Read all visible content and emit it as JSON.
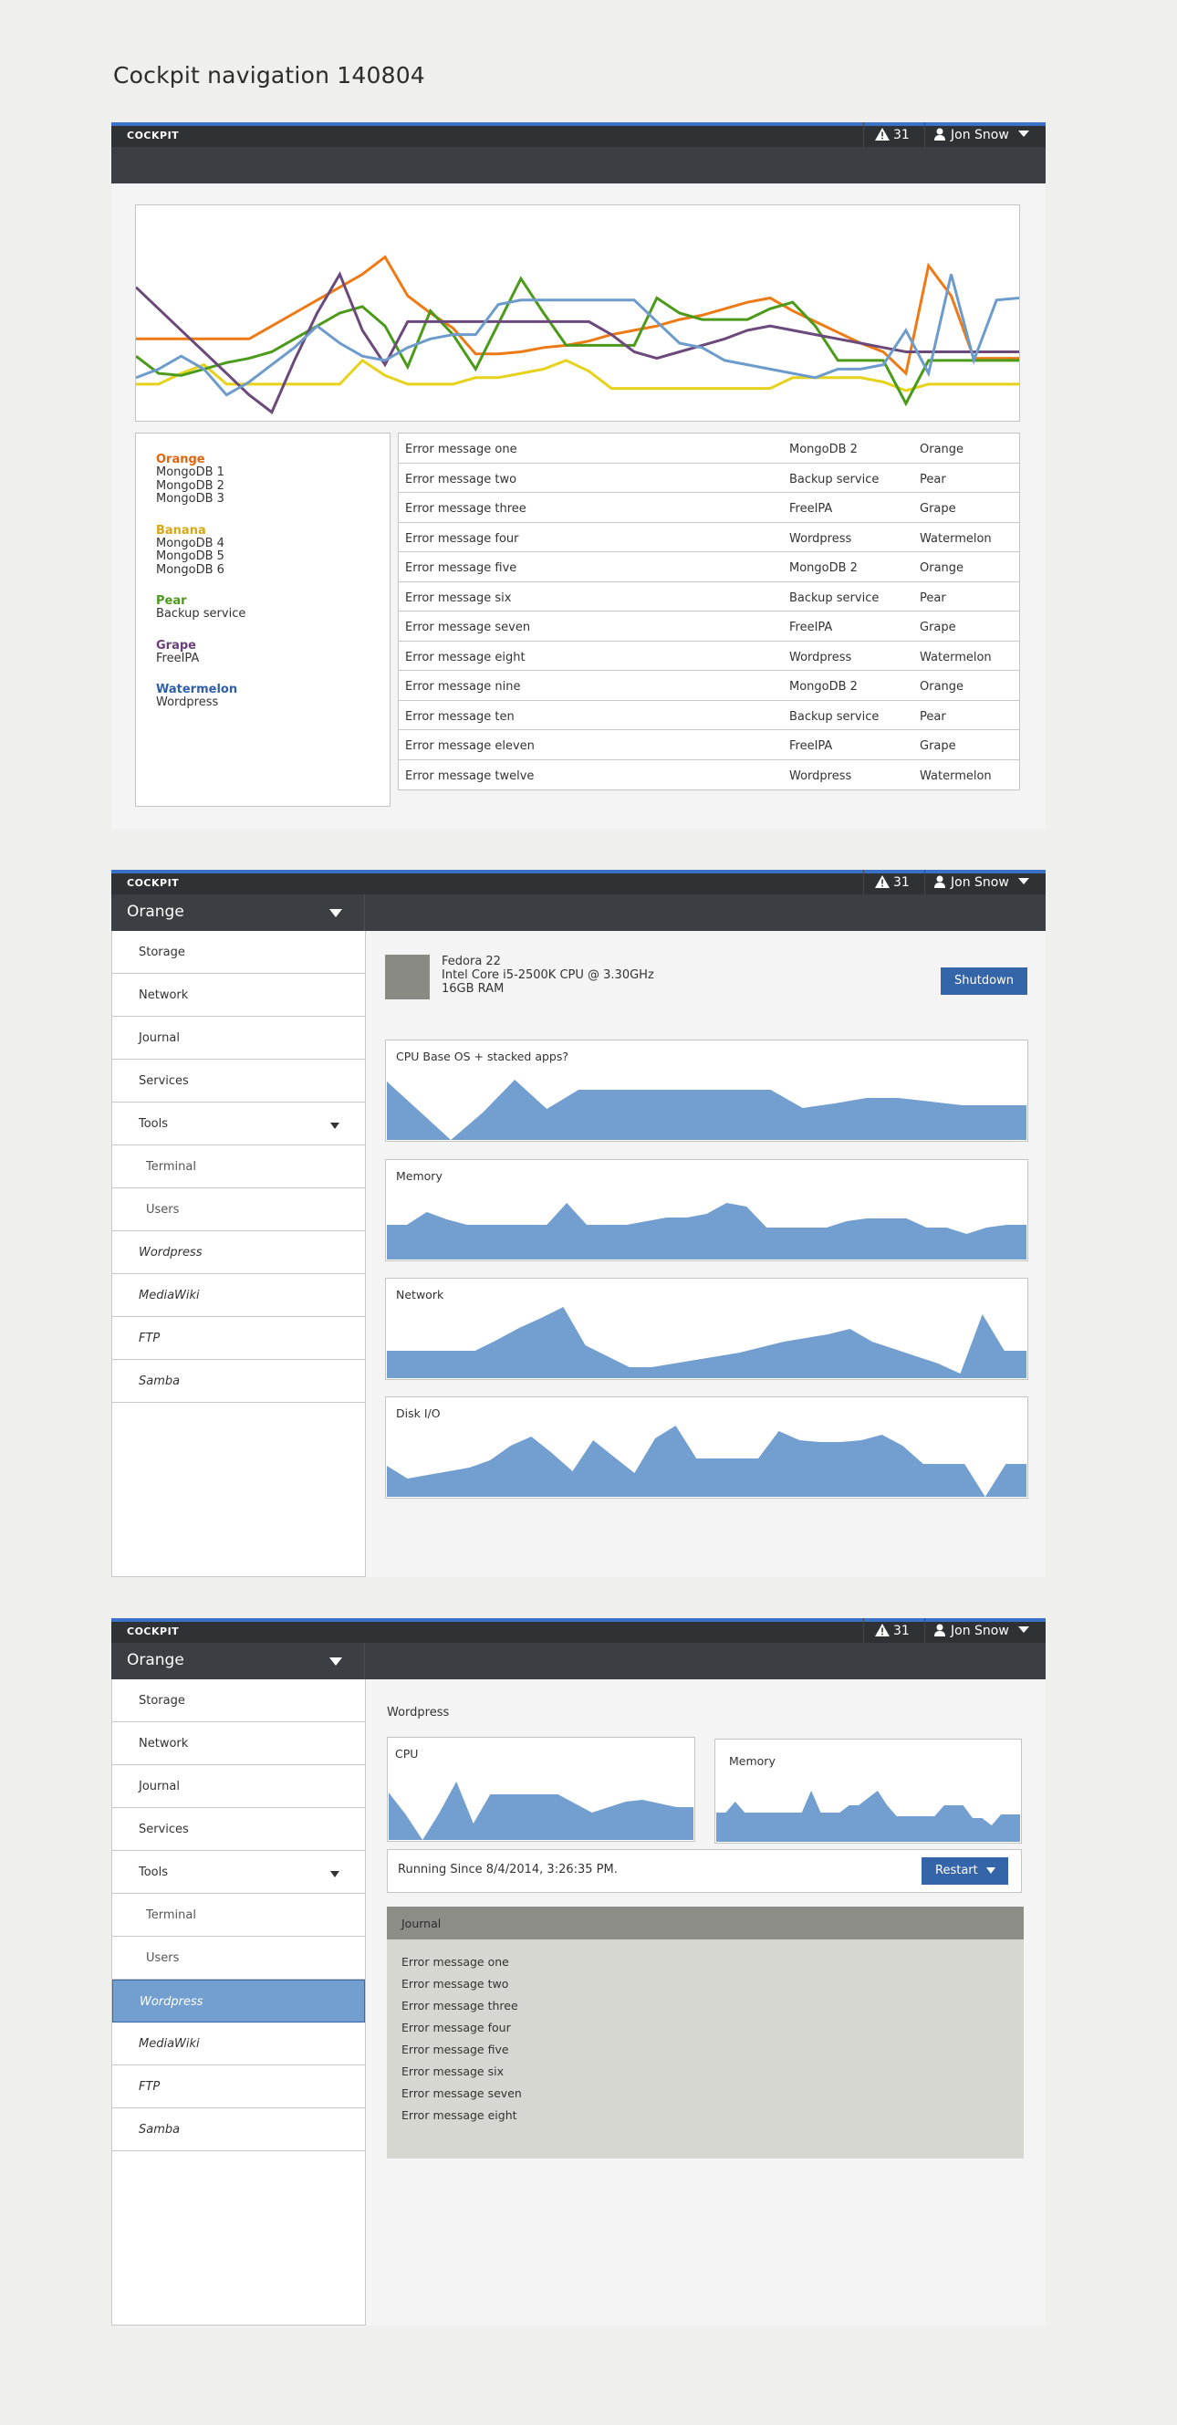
{
  "page": {
    "title": "Cockpit navigation 140804"
  },
  "topbar": {
    "brand": "COCKPIT",
    "alerts": "31",
    "user": "Jon Snow"
  },
  "colors": {
    "orange": "#ee7a15",
    "banana": "#e6d21a",
    "pear": "#4c9a1a",
    "grape": "#6b4a7b",
    "watermelon": "#6d9ccc",
    "accent_blue": "#3565a9",
    "graph_fill": "#729fcf",
    "topbar_stripe": "#3a72c6"
  },
  "mock1": {
    "chart_data": {
      "type": "line",
      "title": "",
      "xlabel": "",
      "ylabel": "",
      "grid": false,
      "x": [
        0,
        1,
        2,
        3,
        4,
        5,
        6,
        7,
        8,
        9,
        10,
        11,
        12,
        13,
        14,
        15,
        16,
        17,
        18,
        19,
        20,
        21,
        22,
        23,
        24,
        25,
        26,
        27,
        28,
        29,
        30,
        31,
        32,
        33,
        34,
        35,
        36,
        37,
        38,
        39,
        40,
        41,
        42,
        43,
        44,
        45,
        46,
        47,
        48,
        49,
        50
      ],
      "ylim": [
        0,
        100
      ],
      "series": [
        {
          "name": "Orange",
          "color": "#ee7a15",
          "values": [
            38,
            38,
            38,
            38,
            38,
            38,
            44,
            50,
            56,
            62,
            68,
            76,
            58,
            50,
            43,
            31,
            31,
            32,
            34,
            35,
            37,
            40,
            42,
            44,
            47,
            49,
            52,
            55,
            57,
            51,
            46,
            41,
            36,
            32,
            22,
            72,
            58,
            29,
            29,
            29
          ]
        },
        {
          "name": "Banana",
          "color": "#e6d21a",
          "values": [
            17,
            17,
            22,
            26,
            17,
            17,
            17,
            17,
            17,
            17,
            28,
            21,
            17,
            17,
            17,
            20,
            20,
            22,
            24,
            28,
            23,
            15,
            15,
            15,
            15,
            15,
            15,
            15,
            15,
            20,
            20,
            20,
            20,
            18,
            14,
            17,
            17,
            17,
            17,
            17
          ]
        },
        {
          "name": "Pear",
          "color": "#4c9a1a",
          "values": [
            30,
            22,
            21,
            24,
            27,
            29,
            32,
            38,
            44,
            50,
            53,
            44,
            25,
            51,
            40,
            24,
            45,
            66,
            50,
            35,
            35,
            35,
            35,
            57,
            50,
            47,
            47,
            47,
            52,
            55,
            44,
            28,
            28,
            28,
            8,
            28,
            28,
            28,
            28,
            28
          ]
        },
        {
          "name": "Grape",
          "color": "#6b4a7b",
          "values": [
            62,
            52,
            42,
            32,
            22,
            12,
            4,
            28,
            50,
            68,
            42,
            26,
            46,
            46,
            46,
            46,
            46,
            46,
            46,
            46,
            46,
            40,
            32,
            29,
            32,
            35,
            38,
            42,
            44,
            42,
            40,
            38,
            36,
            34,
            32,
            32,
            32,
            32,
            32,
            32
          ]
        },
        {
          "name": "Watermelon",
          "color": "#6d9ccc",
          "values": [
            20,
            24,
            30,
            24,
            12,
            18,
            26,
            34,
            44,
            36,
            30,
            28,
            34,
            38,
            40,
            40,
            54,
            56,
            56,
            56,
            56,
            56,
            56,
            46,
            36,
            34,
            28,
            26,
            24,
            22,
            20,
            24,
            24,
            26,
            42,
            22,
            68,
            28,
            56,
            57
          ]
        }
      ]
    },
    "legend": [
      {
        "name": "Orange",
        "color": "#e0650f",
        "items": [
          "MongoDB 1",
          "MongoDB 2",
          "MongoDB 3"
        ]
      },
      {
        "name": "Banana",
        "color": "#d9a716",
        "items": [
          "MongoDB 4",
          "MongoDB 5",
          "MongoDB 6"
        ]
      },
      {
        "name": "Pear",
        "color": "#4c9a1a",
        "items": [
          "Backup service"
        ]
      },
      {
        "name": "Grape",
        "color": "#6b3f7b",
        "items": [
          "FreeIPA"
        ]
      },
      {
        "name": "Watermelon",
        "color": "#2f5fa8",
        "items": [
          "Wordpress"
        ]
      }
    ],
    "errors": [
      {
        "msg": "Error message one",
        "service": "MongoDB 2",
        "group": "Orange"
      },
      {
        "msg": "Error message two",
        "service": "Backup service",
        "group": "Pear"
      },
      {
        "msg": "Error message three",
        "service": "FreeIPA",
        "group": "Grape"
      },
      {
        "msg": "Error message four",
        "service": "Wordpress",
        "group": "Watermelon"
      },
      {
        "msg": "Error message five",
        "service": "MongoDB 2",
        "group": "Orange"
      },
      {
        "msg": "Error message six",
        "service": "Backup service",
        "group": "Pear"
      },
      {
        "msg": "Error message seven",
        "service": "FreeIPA",
        "group": "Grape"
      },
      {
        "msg": "Error message eight",
        "service": "Wordpress",
        "group": "Watermelon"
      },
      {
        "msg": "Error message nine",
        "service": "MongoDB 2",
        "group": "Orange"
      },
      {
        "msg": "Error message ten",
        "service": "Backup service",
        "group": "Pear"
      },
      {
        "msg": "Error message eleven",
        "service": "FreeIPA",
        "group": "Grape"
      },
      {
        "msg": "Error message twelve",
        "service": "Wordpress",
        "group": "Watermelon"
      }
    ]
  },
  "mock2": {
    "selector": "Orange",
    "nav": [
      {
        "label": "Storage",
        "kind": "top"
      },
      {
        "label": "Network",
        "kind": "top"
      },
      {
        "label": "Journal",
        "kind": "top"
      },
      {
        "label": "Services",
        "kind": "top"
      },
      {
        "label": "Tools",
        "kind": "top",
        "expand": true
      },
      {
        "label": "Terminal",
        "kind": "sub"
      },
      {
        "label": "Users",
        "kind": "sub"
      },
      {
        "label": "Wordpress",
        "kind": "app"
      },
      {
        "label": "MediaWiki",
        "kind": "app"
      },
      {
        "label": "FTP",
        "kind": "app"
      },
      {
        "label": "Samba",
        "kind": "app"
      }
    ],
    "server": {
      "os": "Fedora 22",
      "cpu": "Intel Core i5-2500K CPU @ 3.30GHz",
      "ram": "16GB RAM"
    },
    "shutdown_label": "Shutdown",
    "graphs": [
      {
        "label": "CPU Base OS + stacked apps?",
        "values": [
          64,
          32,
          0,
          30,
          66,
          34,
          55,
          55,
          55,
          55,
          55,
          55,
          55,
          35,
          40,
          46,
          46,
          42,
          38,
          38,
          38
        ]
      },
      {
        "label": "Memory",
        "values": [
          38,
          38,
          52,
          44,
          38,
          38,
          38,
          38,
          38,
          62,
          38,
          38,
          38,
          42,
          46,
          46,
          50,
          62,
          58,
          35,
          35,
          35,
          35,
          42,
          45,
          45,
          45,
          35,
          35,
          28,
          35,
          38,
          38
        ]
      },
      {
        "label": "Network",
        "values": [
          30,
          30,
          30,
          30,
          30,
          42,
          55,
          66,
          78,
          36,
          24,
          12,
          12,
          16,
          20,
          24,
          28,
          34,
          40,
          44,
          48,
          54,
          40,
          32,
          24,
          16,
          5,
          70,
          30,
          30
        ]
      },
      {
        "label": "Disk I/O",
        "values": [
          34,
          20,
          24,
          28,
          32,
          40,
          56,
          66,
          48,
          28,
          62,
          44,
          26,
          64,
          78,
          42,
          42,
          42,
          42,
          72,
          62,
          60,
          60,
          62,
          68,
          56,
          36,
          36,
          36,
          0,
          36,
          36
        ]
      }
    ]
  },
  "mock3": {
    "selector": "Orange",
    "active_nav": "Wordpress",
    "section": "Wordpress",
    "cpu_label": "CPU",
    "memory_label": "Memory",
    "cpu_values": [
      52,
      28,
      0,
      30,
      64,
      18,
      50,
      50,
      50,
      50,
      50,
      40,
      30,
      36,
      42,
      44,
      40,
      36,
      36
    ],
    "memory_values": [
      32,
      32,
      44,
      32,
      32,
      32,
      32,
      32,
      32,
      32,
      56,
      32,
      32,
      32,
      40,
      40,
      48,
      56,
      40,
      28,
      28,
      28,
      28,
      28,
      40,
      40,
      40,
      26,
      26,
      18,
      30,
      30,
      30
    ],
    "running": "Running Since 8/4/2014, 3:26:35 PM.",
    "restart_label": "Restart",
    "journal_title": "Journal",
    "journal": [
      "Error message one",
      "Error message two",
      "Error message three",
      "Error message four",
      "Error message five",
      "Error message six",
      "Error message seven",
      "Error message eight"
    ]
  }
}
